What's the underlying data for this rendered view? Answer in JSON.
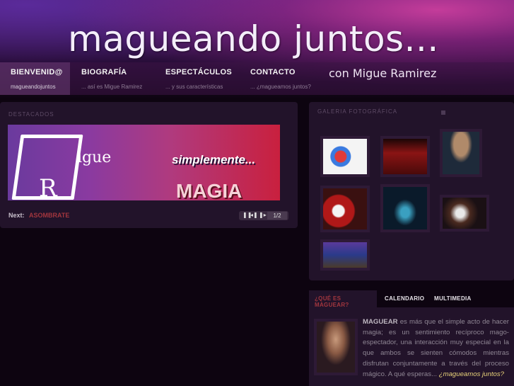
{
  "site": {
    "title": "magueando juntos...",
    "tagline": "con Migue Ramirez"
  },
  "nav": {
    "items": [
      {
        "label": "BIENVENID@",
        "sub": "magueandojuntos",
        "active": true
      },
      {
        "label": "BIOGRAFÍA",
        "sub": "... así es Migue Ramirez",
        "active": false
      },
      {
        "label": "ESPECTÁCULOS",
        "sub": "... y sus características",
        "active": false
      },
      {
        "label": "CONTACTO",
        "sub": "... ¿magueamos juntos?",
        "active": false
      }
    ]
  },
  "featured": {
    "title": "DESTACADOS",
    "banner": {
      "name_top": "igue",
      "name_bottom": "R",
      "slogan": "simplemente...",
      "headline": "MAGIA"
    },
    "next_label": "Next:",
    "next_value": "ASOMBRATE",
    "counter": "1/2"
  },
  "gallery": {
    "title": "GALERIA FOTOGRÁFICA"
  },
  "tabs": {
    "items": [
      "¿QUÉ ES MAGUEAR?",
      "CALENDARIO",
      "MULTIMEDIA"
    ]
  },
  "about": {
    "lead": "MAGUEAR",
    "body": " es más que el simple acto de hacer magia; es un sentimiento recíproco mago-espectador, una interacción muy especial en la que ambos se sienten cómodos mientras disfrutan conjuntamente a través del proceso mágico. A qué esperas... ",
    "link": "¿magueamos juntos?"
  },
  "colors": {
    "accent": "#a2363e",
    "panel": "#22132a",
    "link": "#e8d27a"
  }
}
